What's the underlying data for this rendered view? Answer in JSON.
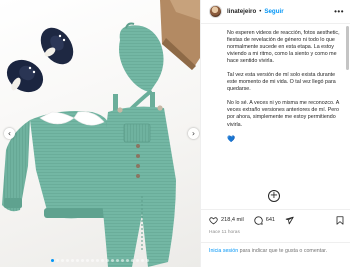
{
  "post": {
    "image_alt": "Conjunto de bebé verde agua con gorro, body con cuello blanco y zapatitos azul marino",
    "carousel_total": 20,
    "carousel_active": 0
  },
  "header": {
    "username": "linatejeiro",
    "separator": "•",
    "follow_label": "Seguir",
    "more_icon": "more-horizontal-icon"
  },
  "caption": {
    "paragraphs": [
      "No esperen videos de reacción, fotos aesthetic, fiestas de revelación de género ni todo lo que normalmente sucede en esta etapa. La estoy viviendo a mi ritmo, como la siento y como me hace sentido vivirla.",
      "Tal vez esta versión de mí solo exista durante este momento de mi vida. O tal vez llegó para quedarse.",
      "No lo sé. A veces ni yo misma me reconozco. A veces extraño versiones anteriores de mí. Pero por ahora, simplemente me estoy permitiendo vivirla."
    ],
    "emoji": "💙"
  },
  "actions": {
    "likes": "218,4 mil",
    "comments": "641"
  },
  "timestamp": "Hace 11 horas",
  "login_prompt": {
    "link": "Inicia sesión",
    "text": " para indicar que te gusta o comentar."
  },
  "colors": {
    "accent": "#0095f6",
    "knit_green": "#72b5a2",
    "navy": "#1f2a44"
  }
}
